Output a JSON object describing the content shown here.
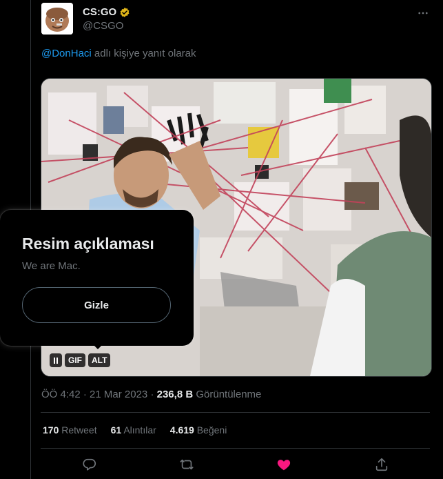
{
  "tweet": {
    "display_name": "CS:GO",
    "handle": "@CSGO",
    "reply_to_mention": "@DonHaci",
    "reply_to_suffix": " adlı kişiye yanıt olarak",
    "more_icon": "ellipsis-icon",
    "verified_icon": "verified-badge-icon",
    "verified_color": "#e2b719"
  },
  "media": {
    "type": "GIF",
    "controls": {
      "pause_icon": "pause-icon",
      "gif_label": "GIF",
      "alt_label": "ALT"
    },
    "alt_popup": {
      "title": "Resim açıklaması",
      "description": "We are Mac.",
      "hide_button": "Gizle"
    }
  },
  "meta": {
    "time": "ÖÖ 4:42",
    "separator": "·",
    "date": "21 Mar 2023",
    "views_count": "236,8 B",
    "views_label": "Görüntülenme"
  },
  "stats": [
    {
      "count": "170",
      "label": "Retweet"
    },
    {
      "count": "61",
      "label": "Alıntılar"
    },
    {
      "count": "4.619",
      "label": "Beğeni"
    }
  ],
  "actions": {
    "reply_icon": "reply-icon",
    "retweet_icon": "retweet-icon",
    "like_icon": "heart-icon",
    "share_icon": "share-icon",
    "like_color": "#f91880",
    "accent_color": "#1d9bf0"
  }
}
